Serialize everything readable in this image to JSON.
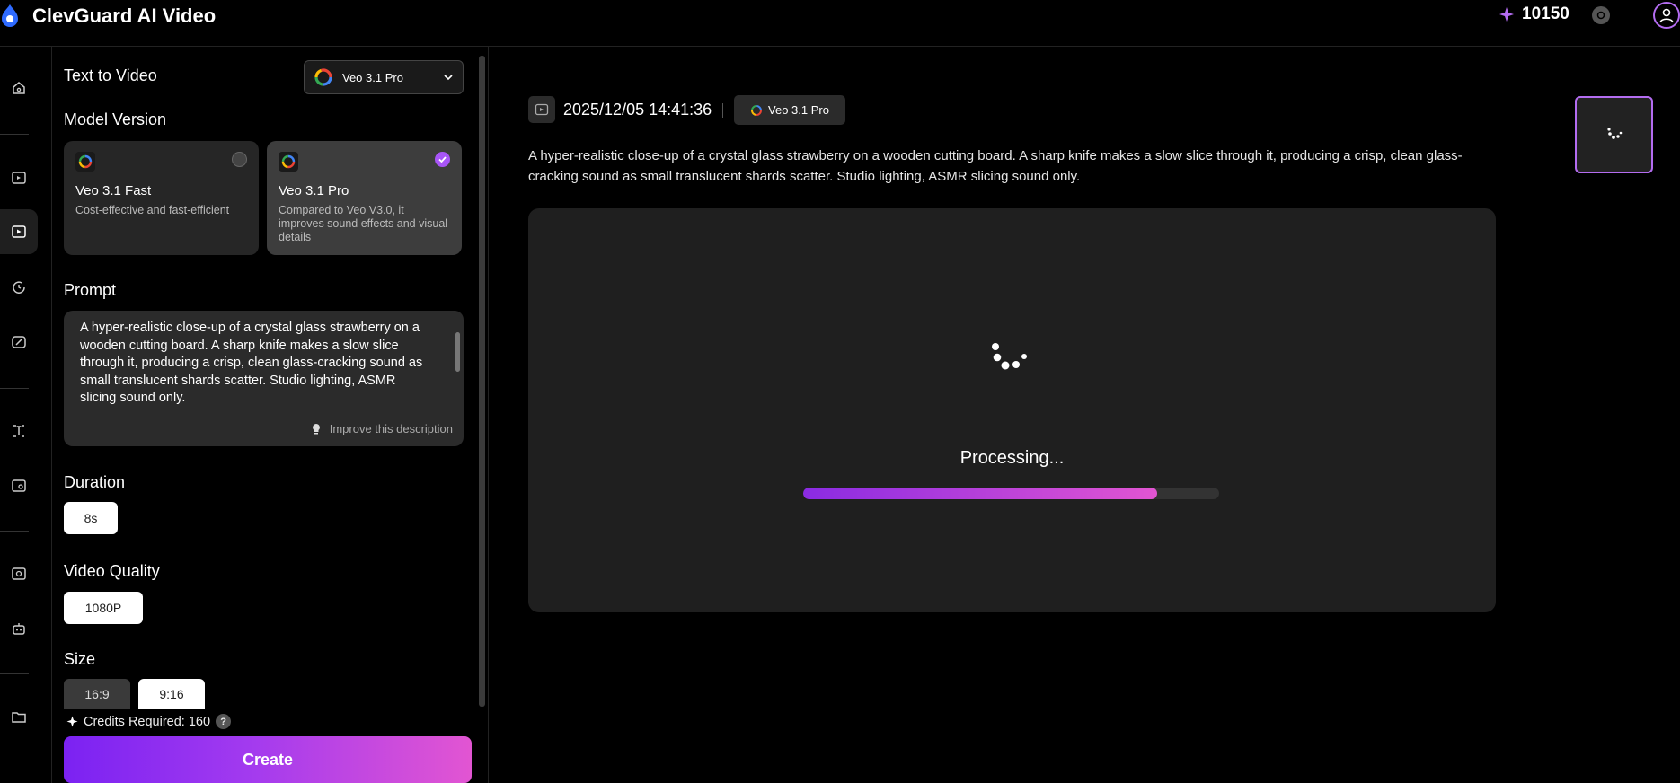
{
  "header": {
    "app_title": "ClevGuard AI Video",
    "credits": "10150"
  },
  "rail": {
    "items": [
      "home",
      "image-to-video",
      "text-to-video",
      "history",
      "effects",
      "text-tool",
      "image-tool",
      "face-tool",
      "robot",
      "folder"
    ]
  },
  "panel": {
    "mode_title": "Text to Video",
    "selected_model": "Veo 3.1 Pro",
    "model_version_label": "Model Version",
    "models": [
      {
        "name": "Veo 3.1 Fast",
        "desc": "Cost-effective and fast-efficient",
        "selected": false
      },
      {
        "name": "Veo 3.1 Pro",
        "desc": "Compared to Veo V3.0, it improves sound effects and visual details",
        "selected": true
      }
    ],
    "prompt_label": "Prompt",
    "prompt_text": "A hyper-realistic close-up of a crystal glass strawberry on a wooden cutting board. A sharp knife makes a slow slice through it, producing a crisp, clean glass-cracking sound as small translucent shards scatter. Studio lighting, ASMR slicing sound only.",
    "improve_label": "Improve this description",
    "duration_label": "Duration",
    "duration_value": "8s",
    "quality_label": "Video Quality",
    "quality_value": "1080P",
    "size_label": "Size",
    "size_options": [
      "16:9",
      "9:16"
    ],
    "size_selected": "9:16",
    "credits_required": "Credits Required: 160",
    "create_label": "Create"
  },
  "main": {
    "timestamp": "2025/12/05 14:41:36",
    "model_tag": "Veo 3.1 Pro",
    "description": "A hyper-realistic close-up of a crystal glass strawberry on a wooden cutting board. A sharp knife makes a slow slice through it, producing a crisp, clean glass-cracking sound as small translucent shards scatter. Studio lighting, ASMR slicing sound only.",
    "status": "Processing...",
    "progress": 0.85
  },
  "colors": {
    "accent": "#a855f7",
    "gradient_start": "#7b22f2",
    "gradient_end": "#e255d2"
  }
}
